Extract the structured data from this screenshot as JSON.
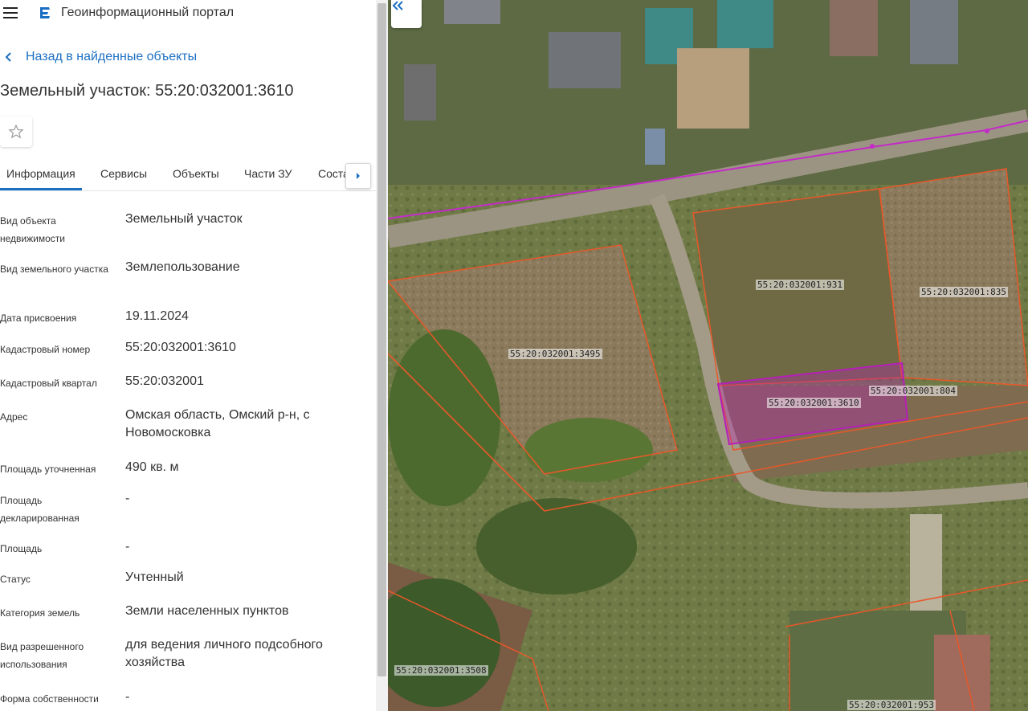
{
  "header": {
    "portal_title": "Геоинформационный портал"
  },
  "back_link": "Назад в найденные объекты",
  "page_title": "Земельный участок: 55:20:032001:3610",
  "tabs": [
    {
      "label": "Информация",
      "active": true
    },
    {
      "label": "Сервисы"
    },
    {
      "label": "Объекты"
    },
    {
      "label": "Части ЗУ"
    },
    {
      "label": "Соста"
    }
  ],
  "properties": [
    {
      "label": "Вид объекта недвижимости",
      "value": "Земельный участок"
    },
    {
      "label": "Вид земельного участка",
      "value": "Землепользование"
    },
    {
      "label": "Дата присвоения",
      "value": "19.11.2024"
    },
    {
      "label": "Кадастровый номер",
      "value": "55:20:032001:3610"
    },
    {
      "label": "Кадастровый квартал",
      "value": "55:20:032001"
    },
    {
      "label": "Адрес",
      "value": "Омская область, Омский р-н, с Новомосковка"
    },
    {
      "label": "Площадь уточненная",
      "value": "490 кв. м"
    },
    {
      "label": "Площадь декларированная",
      "value": "-"
    },
    {
      "label": "Площадь",
      "value": "-"
    },
    {
      "label": "Статус",
      "value": "Учтенный"
    },
    {
      "label": "Категория земель",
      "value": "Земли населенных пунктов"
    },
    {
      "label": "Вид разрешенного использования",
      "value": "для ведения личного подсобного хозяйства"
    },
    {
      "label": "Форма собственности",
      "value": "-"
    }
  ],
  "map": {
    "parcels": [
      {
        "label": "55:20:032001:931"
      },
      {
        "label": "55:20:032001:835"
      },
      {
        "label": "55:20:032001:3495"
      },
      {
        "label": "55:20:032001:804"
      },
      {
        "label": "55:20:032001:3610"
      },
      {
        "label": "55:20:032001:3508"
      },
      {
        "label": "55:20:032001:953"
      }
    ]
  },
  "colors": {
    "accent": "#1b6fc2",
    "parcel_border": "#e8582a",
    "selected_parcel": "#b61fb8",
    "road_line": "#c42bc7"
  },
  "icons": {
    "menu": "hamburger-icon",
    "logo": "portal-logo-icon",
    "back": "chevron-left-icon",
    "favorite": "star-icon",
    "tabs_scroll": "caret-right-icon",
    "collapse": "double-chevron-left-icon"
  }
}
